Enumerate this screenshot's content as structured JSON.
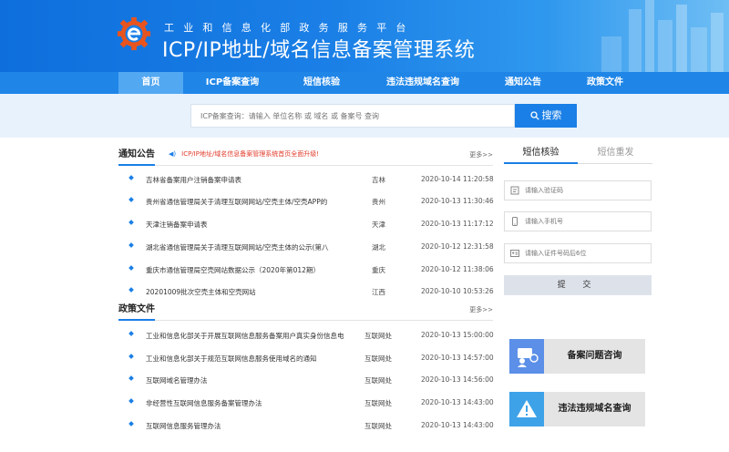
{
  "header": {
    "subtitle": "工业和信息化部政务服务平台",
    "title": "ICP/IP地址/域名信息备案管理系统"
  },
  "nav": {
    "items": [
      {
        "label": "首页",
        "active": true
      },
      {
        "label": "ICP备案查询",
        "active": false
      },
      {
        "label": "短信核验",
        "active": false
      },
      {
        "label": "违法违规域名查询",
        "active": false
      },
      {
        "label": "通知公告",
        "active": false
      },
      {
        "label": "政策文件",
        "active": false
      }
    ]
  },
  "search": {
    "placeholder": "ICP备案查询：请输入 单位名称 或 域名 或 备案号 查询",
    "button_label": "搜索"
  },
  "notices": {
    "title": "通知公告",
    "ticker": "ICP/IP地址/域名信息备案管理系统首页全面升级!",
    "more": "更多>>",
    "items": [
      {
        "title": "吉林省备案用户注销备案申请表",
        "region": "吉林",
        "date": "2020-10-14 11:20:58"
      },
      {
        "title": "贵州省通信管理局关于清理互联网网站/空壳主体/空壳APP的",
        "region": "贵州",
        "date": "2020-10-13 11:30:46"
      },
      {
        "title": "天津注销备案申请表",
        "region": "天津",
        "date": "2020-10-13 11:17:12"
      },
      {
        "title": "湖北省通信管理局关于清理互联网网站/空壳主体的公示(第八",
        "region": "湖北",
        "date": "2020-10-12 12:31:58"
      },
      {
        "title": "重庆市通信管理局空壳网站数据公示（2020年第012期）",
        "region": "重庆",
        "date": "2020-10-12 11:38:06"
      },
      {
        "title": "20201009批次空壳主体和空壳网站",
        "region": "江西",
        "date": "2020-10-10 10:53:26"
      }
    ]
  },
  "policies": {
    "title": "政策文件",
    "more": "更多>>",
    "items": [
      {
        "title": "工业和信息化部关于开展互联网信息服务备案用户真实身份信息电",
        "region": "互联网处",
        "date": "2020-10-13 15:00:00"
      },
      {
        "title": "工业和信息化部关于规范互联网信息服务使用域名的通知",
        "region": "互联网处",
        "date": "2020-10-13 14:57:00"
      },
      {
        "title": "互联网域名管理办法",
        "region": "互联网处",
        "date": "2020-10-13 14:56:00"
      },
      {
        "title": "非经营性互联网信息服务备案管理办法",
        "region": "互联网处",
        "date": "2020-10-13 14:43:00"
      },
      {
        "title": "互联网信息服务管理办法",
        "region": "互联网处",
        "date": "2020-10-13 14:43:00"
      }
    ]
  },
  "sms": {
    "tab_active": "短信核验",
    "tab_inactive": "短信重发",
    "code_placeholder": "请输入验证码",
    "phone_placeholder": "请输入手机号",
    "id_placeholder": "请输入证件号码后6位",
    "submit_label": "提 交"
  },
  "promos": {
    "faq_label": "备案问题咨询",
    "illegal_label": "违法违规域名查询"
  },
  "colors": {
    "brand": "#1a7fe6",
    "ticker": "#e23a2a"
  }
}
